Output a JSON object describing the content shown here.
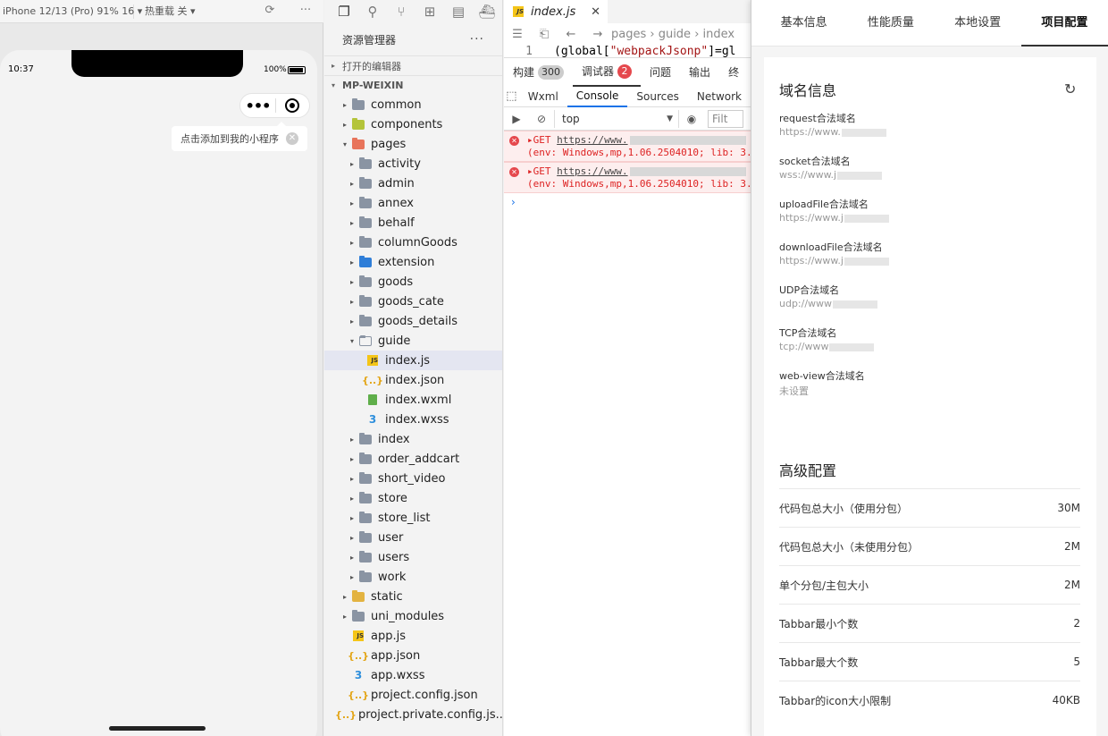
{
  "simulator": {
    "device": "iPhone 12/13 (Pro) 91% 16 ▾",
    "hot_reload": "热重载 关 ▾",
    "time": "10:37",
    "battery": "100%",
    "more_glyph": "•••",
    "tip": "点击添加到我的小程序",
    "tip_close": "✕"
  },
  "explorer": {
    "title": "资源管理器",
    "more": "···",
    "open_editors": "打开的编辑器",
    "project": "MP-WEIXIN",
    "tree": [
      {
        "label": "common",
        "depth": 1,
        "arrow": "▸",
        "icon": "folder"
      },
      {
        "label": "components",
        "depth": 1,
        "arrow": "▸",
        "icon": "folder-components"
      },
      {
        "label": "pages",
        "depth": 1,
        "arrow": "▾",
        "icon": "folder-pages"
      },
      {
        "label": "activity",
        "depth": 2,
        "arrow": "▸",
        "icon": "folder"
      },
      {
        "label": "admin",
        "depth": 2,
        "arrow": "▸",
        "icon": "folder"
      },
      {
        "label": "annex",
        "depth": 2,
        "arrow": "▸",
        "icon": "folder"
      },
      {
        "label": "behalf",
        "depth": 2,
        "arrow": "▸",
        "icon": "folder"
      },
      {
        "label": "columnGoods",
        "depth": 2,
        "arrow": "▸",
        "icon": "folder"
      },
      {
        "label": "extension",
        "depth": 2,
        "arrow": "▸",
        "icon": "folder-extension"
      },
      {
        "label": "goods",
        "depth": 2,
        "arrow": "▸",
        "icon": "folder"
      },
      {
        "label": "goods_cate",
        "depth": 2,
        "arrow": "▸",
        "icon": "folder"
      },
      {
        "label": "goods_details",
        "depth": 2,
        "arrow": "▸",
        "icon": "folder"
      },
      {
        "label": "guide",
        "depth": 2,
        "arrow": "▾",
        "icon": "folder-open"
      },
      {
        "label": "index.js",
        "depth": 3,
        "arrow": "",
        "icon": "js",
        "selected": true
      },
      {
        "label": "index.json",
        "depth": 3,
        "arrow": "",
        "icon": "json"
      },
      {
        "label": "index.wxml",
        "depth": 3,
        "arrow": "",
        "icon": "wxml"
      },
      {
        "label": "index.wxss",
        "depth": 3,
        "arrow": "",
        "icon": "wxss"
      },
      {
        "label": "index",
        "depth": 2,
        "arrow": "▸",
        "icon": "folder"
      },
      {
        "label": "order_addcart",
        "depth": 2,
        "arrow": "▸",
        "icon": "folder"
      },
      {
        "label": "short_video",
        "depth": 2,
        "arrow": "▸",
        "icon": "folder"
      },
      {
        "label": "store",
        "depth": 2,
        "arrow": "▸",
        "icon": "folder"
      },
      {
        "label": "store_list",
        "depth": 2,
        "arrow": "▸",
        "icon": "folder"
      },
      {
        "label": "user",
        "depth": 2,
        "arrow": "▸",
        "icon": "folder"
      },
      {
        "label": "users",
        "depth": 2,
        "arrow": "▸",
        "icon": "folder"
      },
      {
        "label": "work",
        "depth": 2,
        "arrow": "▸",
        "icon": "folder"
      },
      {
        "label": "static",
        "depth": 1,
        "arrow": "▸",
        "icon": "folder-static"
      },
      {
        "label": "uni_modules",
        "depth": 1,
        "arrow": "▸",
        "icon": "folder"
      },
      {
        "label": "app.js",
        "depth": 1,
        "arrow": "",
        "icon": "js"
      },
      {
        "label": "app.json",
        "depth": 1,
        "arrow": "",
        "icon": "json"
      },
      {
        "label": "app.wxss",
        "depth": 1,
        "arrow": "",
        "icon": "wxss"
      },
      {
        "label": "project.config.json",
        "depth": 1,
        "arrow": "",
        "icon": "json"
      },
      {
        "label": "project.private.config.js...",
        "depth": 1,
        "arrow": "",
        "icon": "json"
      }
    ]
  },
  "editor": {
    "tab": "index.js",
    "breadcrumb": "pages › guide › index",
    "line_no": "1",
    "code_pre": "(global[",
    "code_str": "\"webpackJsonp\"",
    "code_post": "]=gl"
  },
  "debugger": {
    "tabs": [
      {
        "label": "构建",
        "badge": "300"
      },
      {
        "label": "调试器",
        "badge": "2",
        "active": true
      },
      {
        "label": "问题"
      },
      {
        "label": "输出"
      },
      {
        "label": "终"
      }
    ],
    "console_tabs": [
      "Wxml",
      "Console",
      "Sources",
      "Network"
    ],
    "active_console_tab": "Console",
    "context": "top",
    "filter_placeholder": "Filt",
    "errors": [
      {
        "line1": "GET ",
        "url": "https://www.",
        "line2": "(env: Windows,mp,1.06.2504010; lib: 3."
      },
      {
        "line1": "GET ",
        "url": "https://www.",
        "line2": "(env: Windows,mp,1.06.2504010; lib: 3."
      }
    ],
    "prompt": "›"
  },
  "settings": {
    "tabs": [
      "基本信息",
      "性能质量",
      "本地设置",
      "项目配置"
    ],
    "active_tab": "项目配置",
    "domain_title": "域名信息",
    "domains": [
      {
        "label": "request合法域名",
        "value": "https://www."
      },
      {
        "label": "socket合法域名",
        "value": "wss://www.j"
      },
      {
        "label": "uploadFile合法域名",
        "value": "https://www.j"
      },
      {
        "label": "downloadFile合法域名",
        "value": "https://www.j"
      },
      {
        "label": "UDP合法域名",
        "value": "udp://www"
      },
      {
        "label": "TCP合法域名",
        "value": "tcp://www"
      },
      {
        "label": "web-view合法域名",
        "value": "未设置"
      }
    ],
    "advanced_title": "高级配置",
    "advanced": [
      {
        "label": "代码包总大小（使用分包）",
        "value": "30M"
      },
      {
        "label": "代码包总大小（未使用分包）",
        "value": "2M"
      },
      {
        "label": "单个分包/主包大小",
        "value": "2M"
      },
      {
        "label": "Tabbar最小个数",
        "value": "2"
      },
      {
        "label": "Tabbar最大个数",
        "value": "5"
      },
      {
        "label": "Tabbar的icon大小限制",
        "value": "40KB"
      }
    ]
  }
}
